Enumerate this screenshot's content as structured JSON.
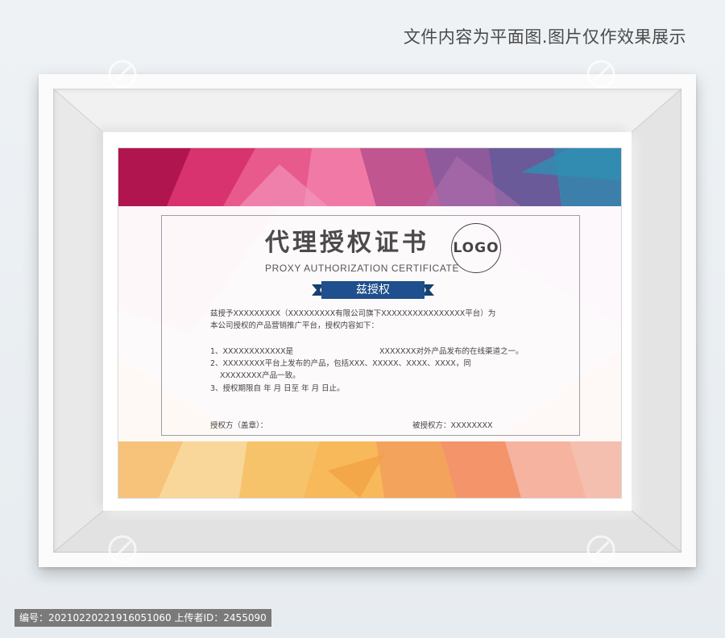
{
  "caption": "文件内容为平面图.图片仅作效果展示",
  "certificate": {
    "title": "代理授权证书",
    "subtitle": "PROXY AUTHORIZATION CERTIFICATE",
    "logo": "LOGO",
    "ribbon": "兹授权",
    "intro_line1": "兹授予XXXXXXXXX（XXXXXXXXX有限公司旗下XXXXXXXXXXXXXXXX平台）为",
    "intro_line2": "本公司授权的产品营销推广平台，授权内容如下：",
    "item1_left": "1、XXXXXXXXXXXX是",
    "item1_right": "XXXXXXX对外产品发布的在线渠道之一。",
    "item2_line1": "2、XXXXXXXX平台上发布的产品，包括XXX、XXXXX、XXXX、XXXX，同",
    "item2_line2": "XXXXXXXX产品一致。",
    "item3": "3、授权期限自          年      月      日至          年      月      日止。",
    "grantor": "授权方（盖章）：",
    "grantee": "被授权方：XXXXXXXX"
  },
  "footer": {
    "id_text": "编号：20210220221916051060 上传者ID：2455090"
  },
  "colors": {
    "ribbon": "#1f4f8c",
    "top_band": [
      "#b0154f",
      "#e0467f",
      "#7a4b8e",
      "#2f7fa8"
    ],
    "bottom_band": [
      "#f6c26a",
      "#f4a062",
      "#f08a6a",
      "#f7d59a"
    ]
  }
}
